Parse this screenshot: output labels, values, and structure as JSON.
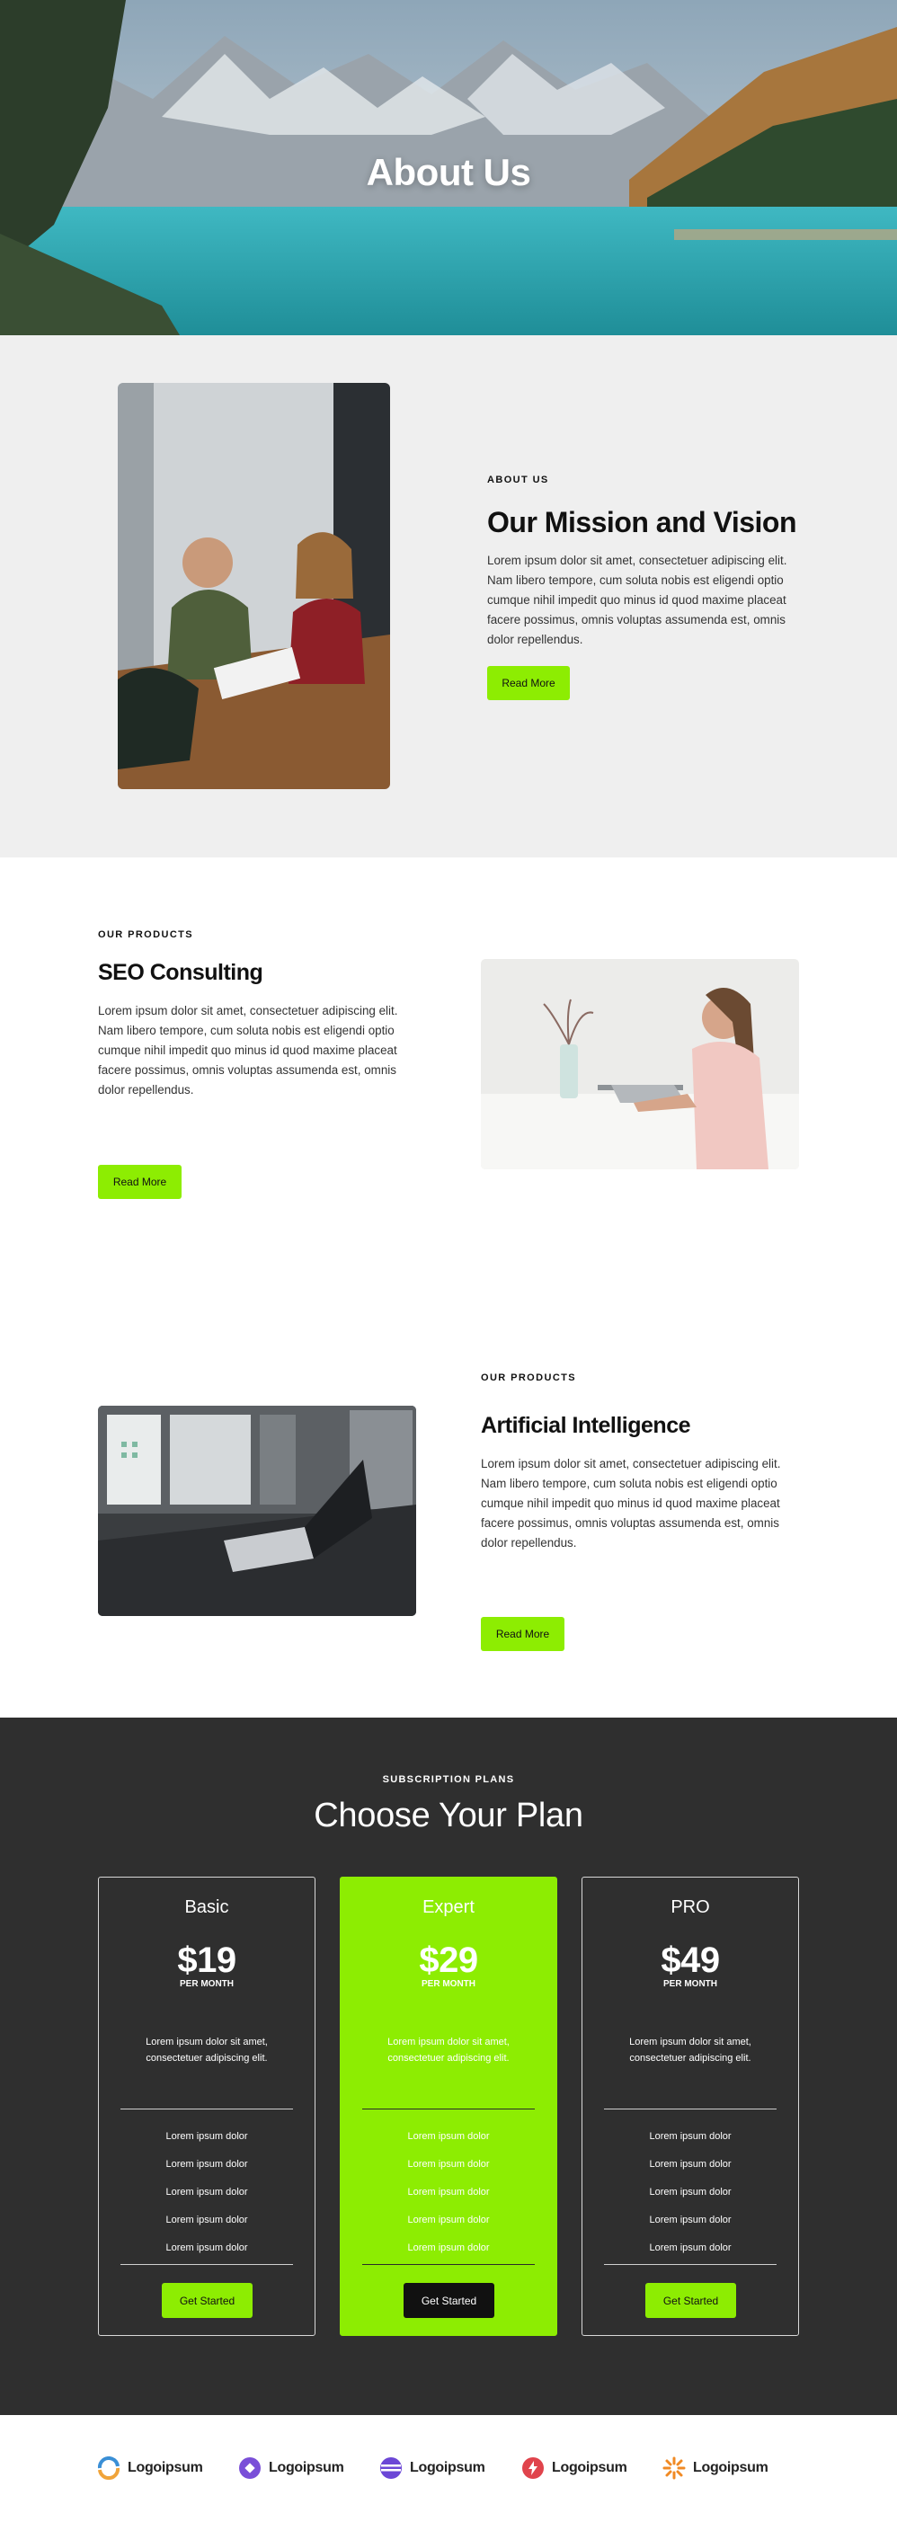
{
  "hero": {
    "title": "About Us"
  },
  "mission": {
    "eyebrow": "ABOUT US",
    "title": "Our Mission and Vision",
    "body": "Lorem ipsum dolor sit amet, consectetuer adipiscing elit. Nam libero tempore, cum soluta nobis est eligendi optio cumque nihil impedit quo minus id quod maxime placeat facere possimus, omnis voluptas assumenda est, omnis dolor repellendus.",
    "button": "Read More"
  },
  "products": [
    {
      "eyebrow": "OUR PRODUCTS",
      "title": "SEO Consulting",
      "body": "Lorem ipsum dolor sit amet, consectetuer adipiscing elit. Nam libero tempore, cum soluta nobis est eligendi optio cumque nihil impedit quo minus id quod maxime placeat facere possimus, omnis voluptas assumenda est, omnis dolor repellendus.",
      "button": "Read More"
    },
    {
      "eyebrow": "OUR PRODUCTS",
      "title": "Artificial Intelligence",
      "body": "Lorem ipsum dolor sit amet, consectetuer adipiscing elit. Nam libero tempore, cum soluta nobis est eligendi optio cumque nihil impedit quo minus id quod maxime placeat facere possimus, omnis voluptas assumenda est, omnis dolor repellendus.",
      "button": "Read More"
    }
  ],
  "plans": {
    "eyebrow": "SUBSCRIPTION PLANS",
    "title": "Choose Your Plan",
    "cards": [
      {
        "name": "Basic",
        "price": "$19",
        "period": "PER MONTH",
        "description": "Lorem ipsum dolor sit amet, consectetuer adipiscing elit.",
        "features": [
          "Lorem ipsum dolor",
          "Lorem ipsum dolor",
          "Lorem ipsum dolor",
          "Lorem ipsum dolor",
          "Lorem ipsum dolor"
        ],
        "button": "Get Started"
      },
      {
        "name": "Expert",
        "price": "$29",
        "period": "PER MONTH",
        "description": "Lorem ipsum dolor sit amet, consectetuer adipiscing elit.",
        "features": [
          "Lorem ipsum dolor",
          "Lorem ipsum dolor",
          "Lorem ipsum dolor",
          "Lorem ipsum dolor",
          "Lorem ipsum dolor"
        ],
        "button": "Get Started"
      },
      {
        "name": "PRO",
        "price": "$49",
        "period": "PER MONTH",
        "description": "Lorem ipsum dolor sit amet, consectetuer adipiscing elit.",
        "features": [
          "Lorem ipsum dolor",
          "Lorem ipsum dolor",
          "Lorem ipsum dolor",
          "Lorem ipsum dolor",
          "Lorem ipsum dolor"
        ],
        "button": "Get Started"
      }
    ]
  },
  "logos": [
    "Logoipsum",
    "Logoipsum",
    "Logoipsum",
    "Logoipsum",
    "Logoipsum"
  ],
  "colors": {
    "accent": "#8ded02",
    "dark": "#2f2f2f",
    "light": "#efefef"
  }
}
